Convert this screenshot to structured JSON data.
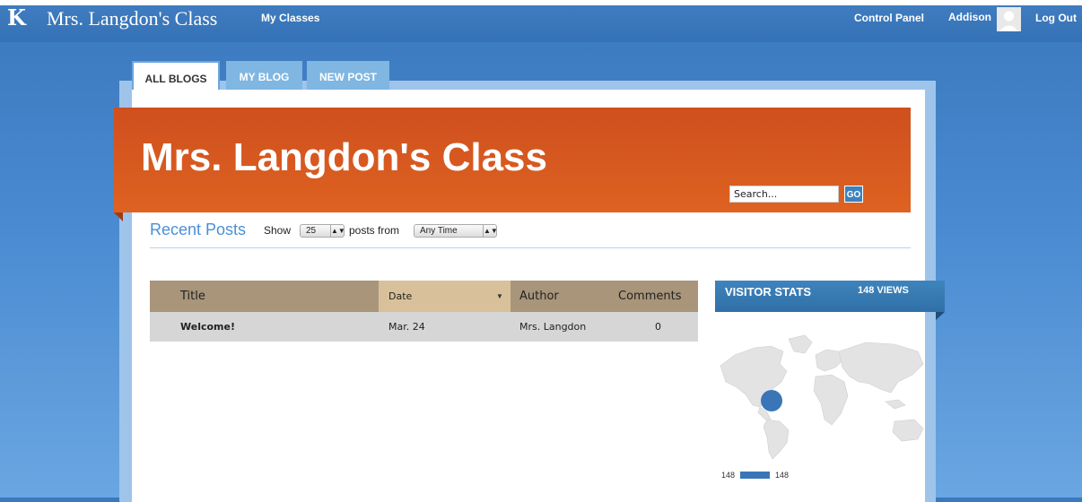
{
  "topbar": {
    "logo_letter": "K",
    "site_title": "Mrs. Langdon's Class",
    "my_classes": "My Classes",
    "control_panel": "Control Panel",
    "username": "Addison",
    "logout": "Log Out"
  },
  "tabs": [
    {
      "label": "ALL BLOGS",
      "active": true
    },
    {
      "label": "MY BLOG",
      "active": false
    },
    {
      "label": "NEW POST",
      "active": false
    }
  ],
  "banner": {
    "title": "Mrs. Langdon's Class",
    "search_value": "Search...",
    "search_button": "GO"
  },
  "recent_posts": {
    "title": "Recent Posts",
    "show_label": "Show",
    "count_value": "25",
    "posts_from_label": "posts from",
    "time_value": "Any Time"
  },
  "table": {
    "headers": {
      "title": "Title",
      "date": "Date",
      "author": "Author",
      "comments": "Comments"
    },
    "rows": [
      {
        "title": "Welcome!",
        "date": "Mar. 24",
        "author": "Mrs. Langdon",
        "comments": "0"
      }
    ]
  },
  "visitor_stats": {
    "title": "VISITOR STATS",
    "views": "148 VIEWS",
    "legend_min": "148",
    "legend_max": "148"
  },
  "colors": {
    "accent_blue": "#3a76b7",
    "banner_orange": "#de6221",
    "table_header": "#a8957a"
  },
  "icons": [
    "k-logo-icon",
    "user-avatar-icon",
    "sort-down-icon",
    "select-arrows-icon",
    "world-map-icon"
  ]
}
